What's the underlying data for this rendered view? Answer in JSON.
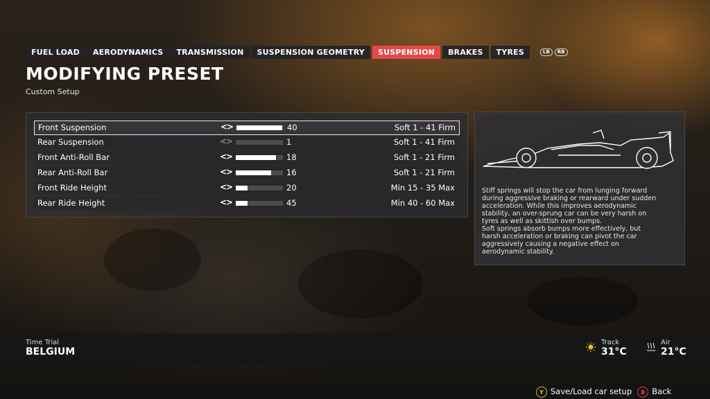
{
  "tabs": [
    {
      "label": "FUEL LOAD",
      "active": false
    },
    {
      "label": "AERODYNAMICS",
      "active": false
    },
    {
      "label": "TRANSMISSION",
      "active": false
    },
    {
      "label": "SUSPENSION GEOMETRY",
      "active": false
    },
    {
      "label": "SUSPENSION",
      "active": true
    },
    {
      "label": "BRAKES",
      "active": false
    },
    {
      "label": "TYRES",
      "active": false
    }
  ],
  "bumpers": {
    "left": "LB",
    "right": "RB"
  },
  "page": {
    "title": "MODIFYING PRESET",
    "subtitle": "Custom Setup"
  },
  "settings": [
    {
      "label": "Front Suspension",
      "arrows": "<>",
      "value": "40",
      "range": "Soft 1 - 41 Firm",
      "fill": 0.975,
      "selected": true,
      "left_disabled": false
    },
    {
      "label": "Rear Suspension",
      "arrows": "<>",
      "value": "1",
      "range": "Soft 1 - 41 Firm",
      "fill": 0.0,
      "selected": false,
      "left_disabled": true
    },
    {
      "label": "Front Anti-Roll Bar",
      "arrows": "<>",
      "value": "18",
      "range": "Soft 1 - 21 Firm",
      "fill": 0.85,
      "selected": false,
      "left_disabled": false
    },
    {
      "label": "Rear Anti-Roll Bar",
      "arrows": "<>",
      "value": "16",
      "range": "Soft 1 - 21 Firm",
      "fill": 0.75,
      "selected": false,
      "left_disabled": false
    },
    {
      "label": "Front Ride Height",
      "arrows": "<>",
      "value": "20",
      "range": "Min 15 - 35 Max",
      "fill": 0.25,
      "selected": false,
      "left_disabled": false
    },
    {
      "label": "Rear Ride Height",
      "arrows": "<>",
      "value": "45",
      "range": "Min 40 - 60 Max",
      "fill": 0.25,
      "selected": false,
      "left_disabled": false
    }
  ],
  "info": {
    "description_lines": [
      "Stiff springs will stop the car from lunging forward",
      "during aggressive braking or rearward under sudden",
      "acceleration. While this improves aerodynamic",
      "stability, an over-sprung car can be very harsh on",
      "tyres as well as skittish over bumps.",
      "Soft springs absorb bumps more effectively, but",
      "harsh acceleration or braking can pivot the car",
      "aggressively causing a negative effect on",
      "aerodynamic stability."
    ]
  },
  "session": {
    "mode": "Time Trial",
    "location": "BELGIUM"
  },
  "weather": {
    "track_label": "Track",
    "track_temp": "31°C",
    "track_icon": "sun-icon",
    "air_label": "Air",
    "air_temp": "21°C",
    "air_icon": "heat-waves-icon"
  },
  "prompts": {
    "save_key": "Y",
    "save_label": "Save/Load car setup",
    "back_key": "B",
    "back_label": "Back"
  },
  "colors": {
    "accent": "#e5484d",
    "yellow_button": "#d8c12a",
    "red_button": "#e0404a"
  }
}
